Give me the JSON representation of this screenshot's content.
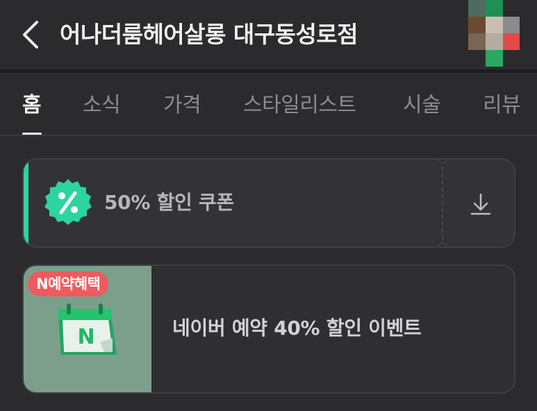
{
  "header": {
    "title": "어나더룸헤어살롱 대구동성로점",
    "back_icon": "chevron-left-icon",
    "thumbnail": "store-thumbnail-blurred"
  },
  "tabs": [
    {
      "label": "홈",
      "active": true
    },
    {
      "label": "소식",
      "active": false
    },
    {
      "label": "가격",
      "active": false
    },
    {
      "label": "스타일리스트",
      "active": false
    },
    {
      "label": "시술",
      "active": false
    },
    {
      "label": "리뷰",
      "active": false
    }
  ],
  "coupon": {
    "label": "50% 할인 쿠폰",
    "badge_icon": "percent-badge-icon",
    "download_icon": "download-icon",
    "accent_color": "#2bd4a0"
  },
  "event": {
    "tag": "N예약혜택",
    "text": "네이버 예약 40% 할인 이벤트",
    "image_icon": "naver-calendar-icon",
    "tag_color": "#ef5a5e"
  },
  "colors": {
    "background": "#2b2b2d",
    "card": "#333336"
  }
}
